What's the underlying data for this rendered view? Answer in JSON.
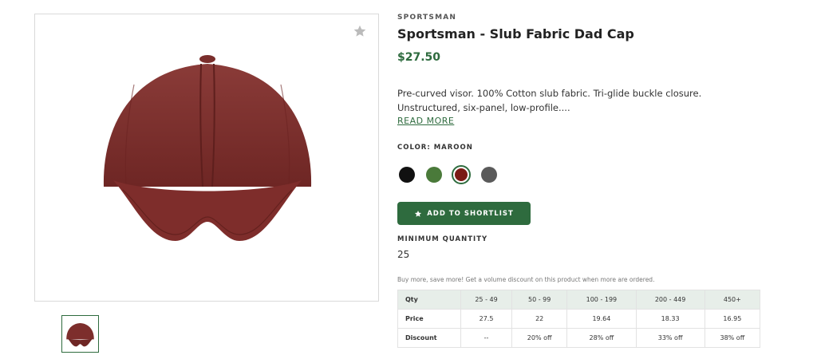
{
  "product": {
    "brand": "SPORTSMAN",
    "title": "Sportsman - Slub Fabric Dad Cap",
    "price": "$27.50",
    "description": "Pre-curved visor. 100% Cotton slub fabric. Tri-glide buckle closure. Unstructured, six-panel, low-profile....",
    "read_more": "READ MORE",
    "color_label": "COLOR: MAROON",
    "swatches": [
      {
        "name": "black",
        "color": "#111111",
        "selected": false
      },
      {
        "name": "green",
        "color": "#4a7a3a",
        "selected": false
      },
      {
        "name": "maroon",
        "color": "#7a1a14",
        "selected": true
      },
      {
        "name": "gray",
        "color": "#5a5a5a",
        "selected": false
      }
    ],
    "shortlist_button": "ADD TO SHORTLIST",
    "min_qty_label": "MINIMUM QUANTITY",
    "min_qty_value": "25",
    "volume_note": "Buy more, save more! Get a volume discount on this product when more are ordered."
  },
  "pricing_table": {
    "header": [
      "Qty",
      "25 - 49",
      "50 - 99",
      "100 - 199",
      "200 - 449",
      "450+"
    ],
    "rows": [
      [
        "Price",
        "27.5",
        "22",
        "19.64",
        "18.33",
        "16.95"
      ],
      [
        "Discount",
        "--",
        "20% off",
        "28% off",
        "33% off",
        "38% off"
      ]
    ]
  },
  "colors": {
    "accent": "#2e6b3e",
    "cap": "#7d2e2c"
  },
  "icons": {
    "favorite": "star-icon",
    "shortlist": "star-icon"
  }
}
